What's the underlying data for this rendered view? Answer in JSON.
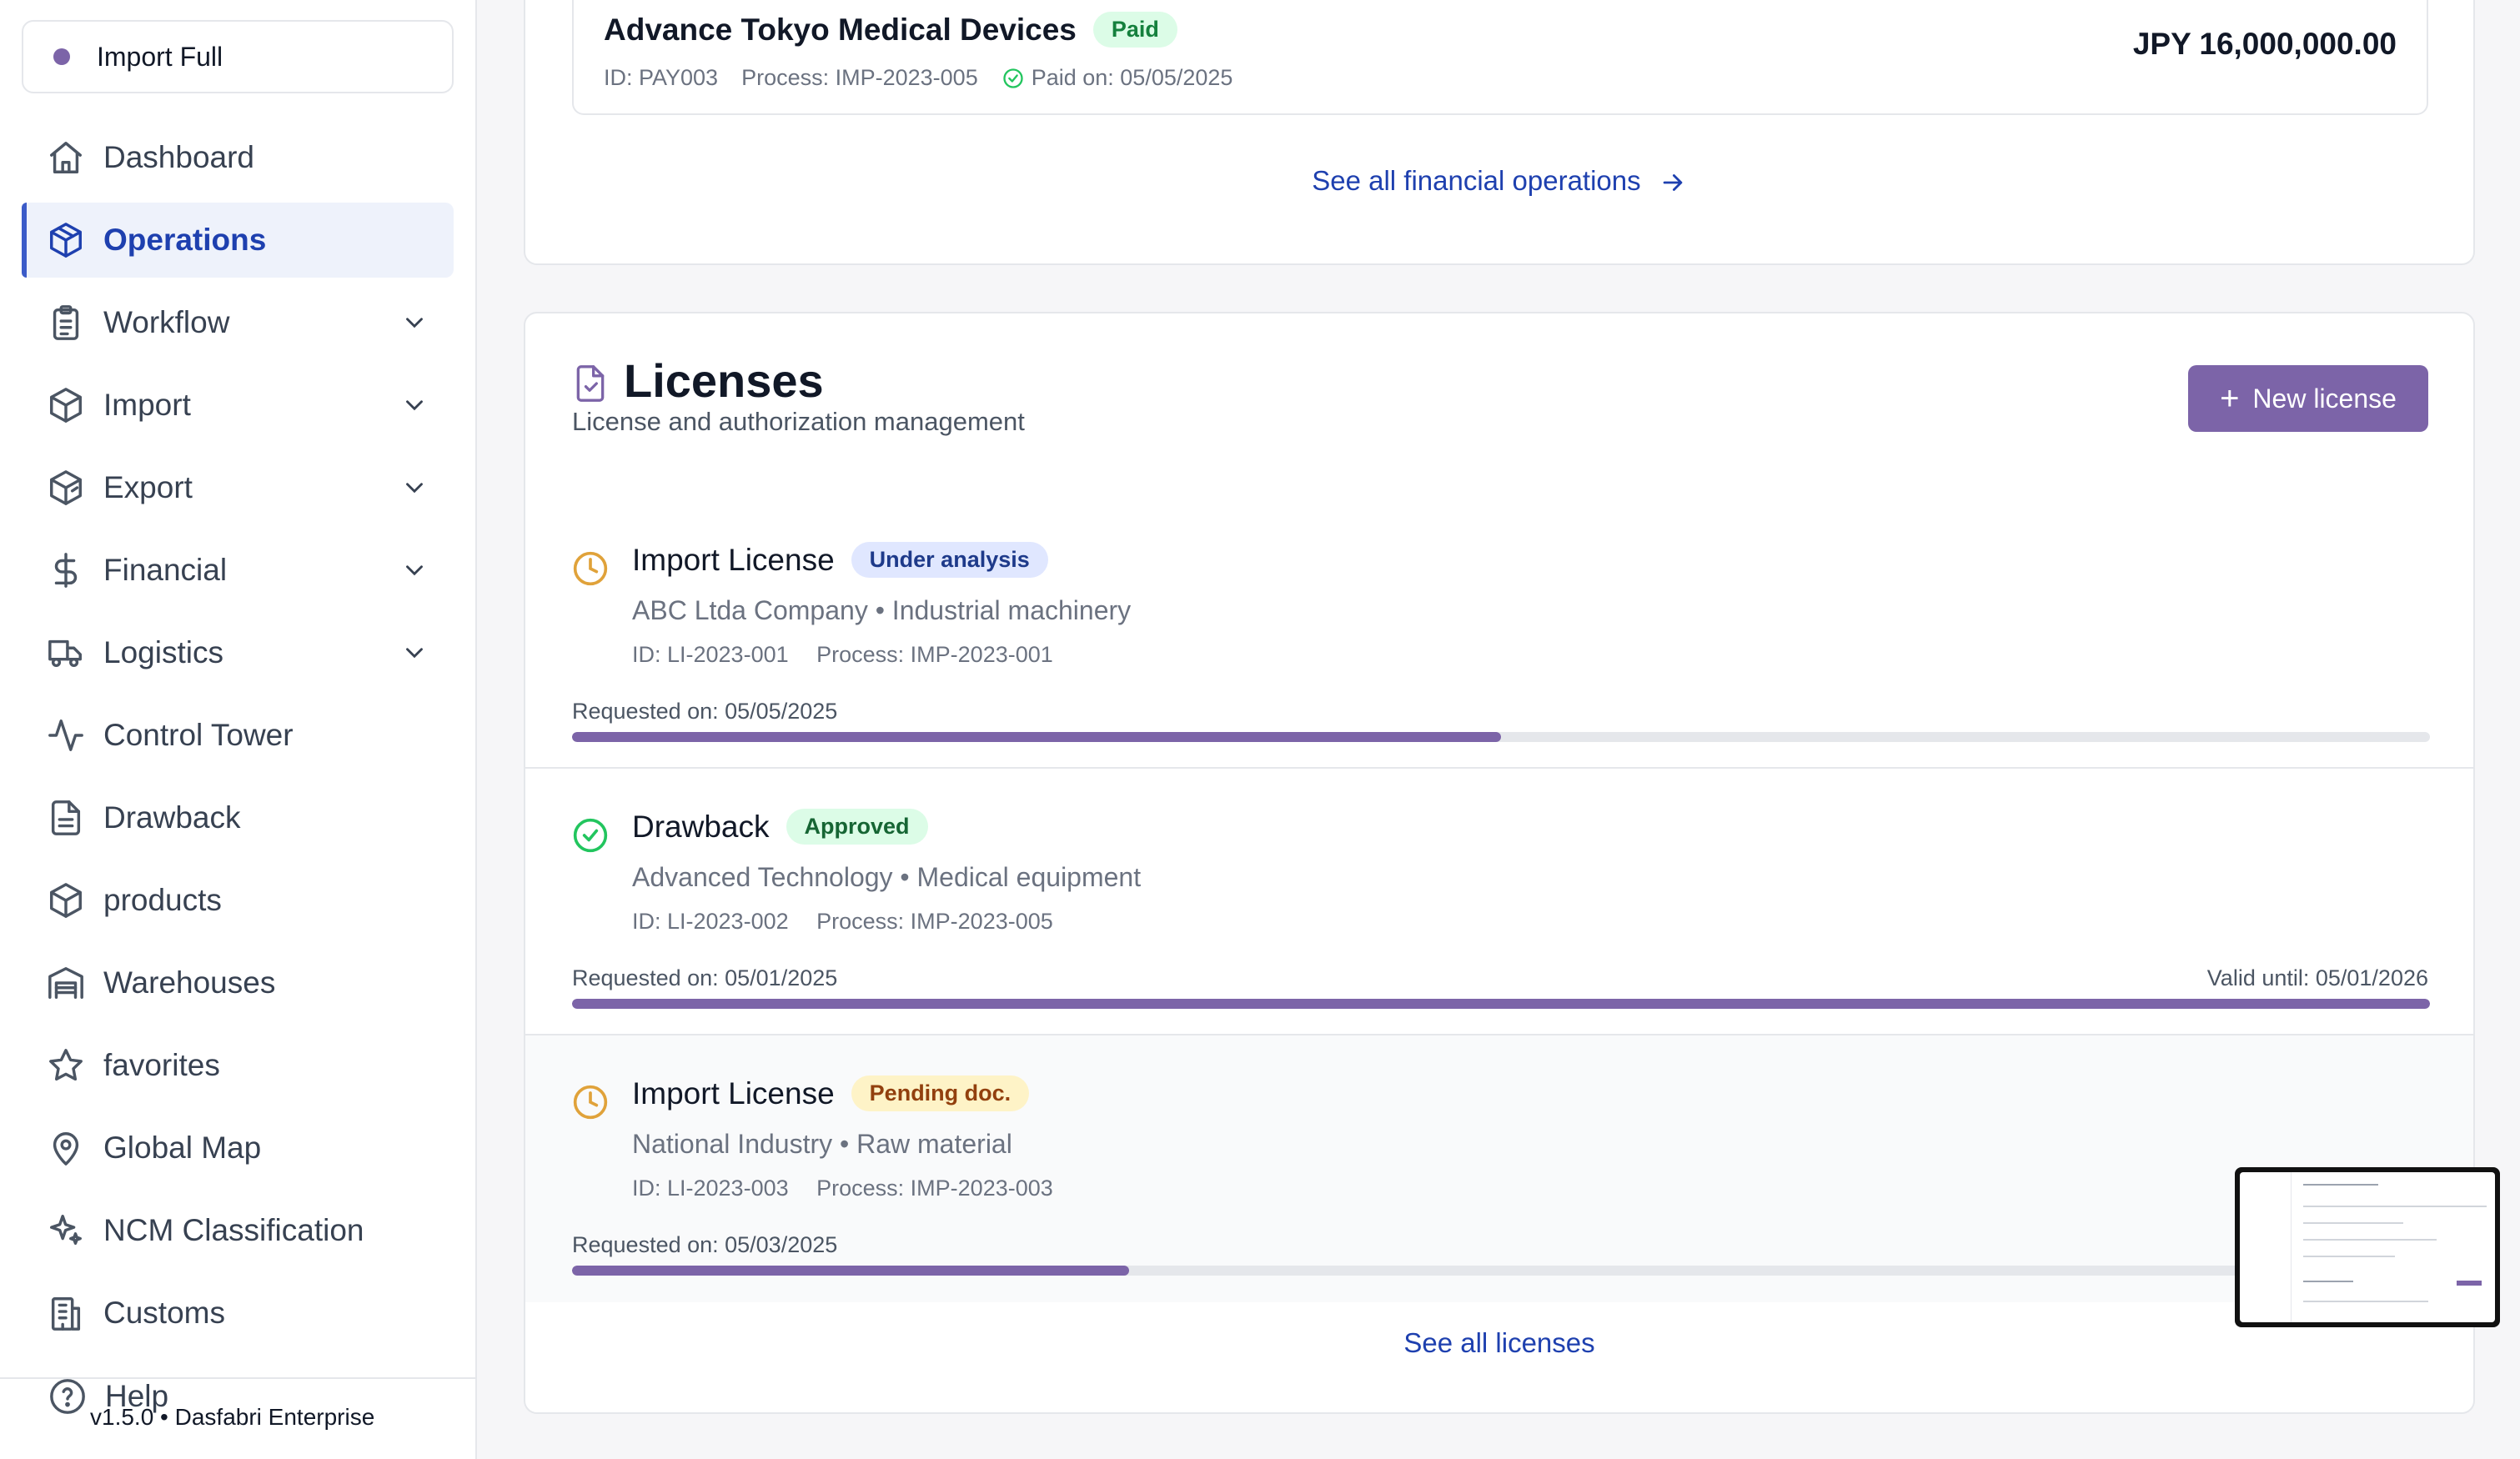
{
  "colors": {
    "accent": "#7c64a8",
    "link": "#1e40af",
    "active_nav_bg": "#eef2fb",
    "success": "#22c55e",
    "warning": "#e0a23a"
  },
  "sidebar": {
    "env_label": "Import Full",
    "items": [
      {
        "label": "Dashboard",
        "icon": "home-icon",
        "active": false,
        "expandable": false
      },
      {
        "label": "Operations",
        "icon": "box-icon",
        "active": true,
        "expandable": false
      },
      {
        "label": "Workflow",
        "icon": "clipboard-icon",
        "active": false,
        "expandable": true
      },
      {
        "label": "Import",
        "icon": "package-icon",
        "active": false,
        "expandable": true
      },
      {
        "label": "Export",
        "icon": "package-export-icon",
        "active": false,
        "expandable": true
      },
      {
        "label": "Financial",
        "icon": "dollar-icon",
        "active": false,
        "expandable": true
      },
      {
        "label": "Logistics",
        "icon": "truck-icon",
        "active": false,
        "expandable": true
      },
      {
        "label": "Control Tower",
        "icon": "activity-icon",
        "active": false,
        "expandable": false
      },
      {
        "label": "Drawback",
        "icon": "file-icon",
        "active": false,
        "expandable": false
      },
      {
        "label": "products",
        "icon": "box-icon",
        "active": false,
        "expandable": false
      },
      {
        "label": "Warehouses",
        "icon": "warehouse-icon",
        "active": false,
        "expandable": false
      },
      {
        "label": "favorites",
        "icon": "star-icon",
        "active": false,
        "expandable": false
      },
      {
        "label": "Global Map",
        "icon": "map-pin-icon",
        "active": false,
        "expandable": false
      },
      {
        "label": "NCM Classification",
        "icon": "sparkles-icon",
        "active": false,
        "expandable": false
      },
      {
        "label": "Customs",
        "icon": "building-icon",
        "active": false,
        "expandable": false
      }
    ],
    "help_label": "Help",
    "version": "v1.5.0 • Dasfabri Enterprise"
  },
  "financial": {
    "payment": {
      "title": "Advance Tokyo Medical Devices",
      "status": "Paid",
      "id": "ID: PAY003",
      "process": "Process: IMP-2023-005",
      "paid_on": "Paid on: 05/05/2025",
      "amount": "JPY 16,000,000.00"
    },
    "see_all": "See all financial operations"
  },
  "licenses": {
    "title": "Licenses",
    "subtitle": "License and authorization management",
    "new_button": "New license",
    "items": [
      {
        "name": "Import License",
        "status": "Under analysis",
        "company": "ABC Ltda Company • Industrial machinery",
        "id": "ID: LI-2023-001",
        "process": "Process: IMP-2023-001",
        "requested": "Requested on: 05/05/2025",
        "valid_until": "",
        "progress": 0.5
      },
      {
        "name": "Drawback",
        "status": "Approved",
        "company": "Advanced Technology • Medical equipment",
        "id": "ID: LI-2023-002",
        "process": "Process: IMP-2023-005",
        "requested": "Requested on: 05/01/2025",
        "valid_until": "Valid until: 05/01/2026",
        "progress": 1.0
      },
      {
        "name": "Import License",
        "status": "Pending doc.",
        "company": "National Industry • Raw material",
        "id": "ID: LI-2023-003",
        "process": "Process: IMP-2023-003",
        "requested": "Requested on: 05/03/2025",
        "valid_until": "",
        "progress": 0.3
      }
    ],
    "see_all": "See all licenses"
  }
}
